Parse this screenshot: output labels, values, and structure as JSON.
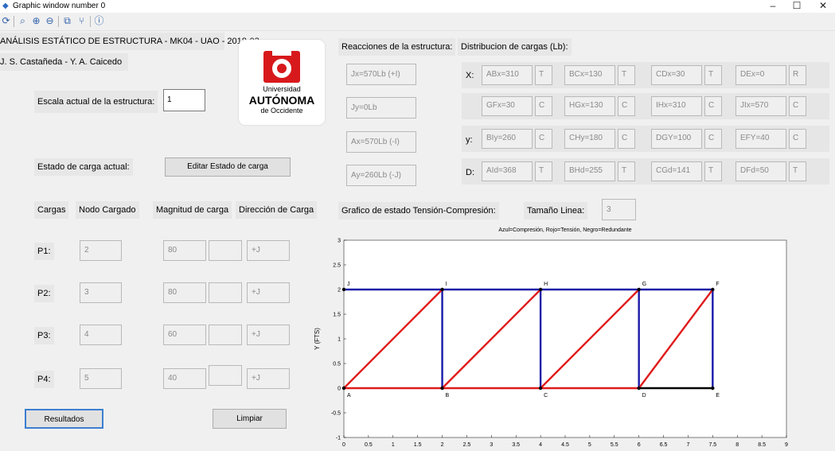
{
  "window": {
    "title": "Graphic window number 0",
    "controls": [
      "–",
      "☐",
      "✕"
    ]
  },
  "toolbar": {
    "icons": [
      "rotate-icon",
      "zoom-icon",
      "zoom-in-icon",
      "zoom-out-icon",
      "datatip-icon",
      "editor-icon",
      "help-icon"
    ]
  },
  "header": {
    "title": "ANÁLISIS ESTÁTICO DE ESTRUCTURA - MK04 - UAO - 2018-03",
    "authors": "J. S. Castañeda - Y. A. Caicedo",
    "logo": {
      "line1": "Universidad",
      "line2": "AUTÓNOMA",
      "line3": "de Occidente",
      "color": "#d7191c"
    }
  },
  "scale": {
    "label": "Escala actual de la estructura:",
    "value": "1"
  },
  "load_state": {
    "label": "Estado de carga actual:",
    "edit_button": "Editar Estado de carga"
  },
  "loads": {
    "headers": [
      "Cargas",
      "Nodo Cargado",
      "Magnitud de carga",
      "Dirección de Carga"
    ],
    "rows": [
      {
        "name": "P1:",
        "node": "2",
        "magnitude": "80",
        "extra": "",
        "direction": "+J"
      },
      {
        "name": "P2:",
        "node": "3",
        "magnitude": "80",
        "extra": "",
        "direction": "+J"
      },
      {
        "name": "P3:",
        "node": "4",
        "magnitude": "60",
        "extra": "",
        "direction": "+J"
      },
      {
        "name": "P4:",
        "node": "5",
        "magnitude": "40",
        "extra": "",
        "direction": "+J"
      }
    ]
  },
  "buttons": {
    "results": "Resultados",
    "clear": "Limpiar"
  },
  "reactions": {
    "label": "Reacciones de la estructura:",
    "values": [
      "Jx=570Lb (+I)",
      "Jy=0Lb",
      "Ax=570Lb (-I)",
      "Ay=260Lb (-J)"
    ]
  },
  "distribution": {
    "label": "Distribucion de cargas (Lb):",
    "rows": [
      {
        "axis": "X:",
        "items": [
          [
            "ABx=310",
            "T"
          ],
          [
            "BCx=130",
            "T"
          ],
          [
            "CDx=30",
            "T"
          ],
          [
            "DEx=0",
            "R"
          ]
        ]
      },
      {
        "axis": "",
        "items": [
          [
            "GFx=30",
            "C"
          ],
          [
            "HGx=130",
            "C"
          ],
          [
            "IHx=310",
            "C"
          ],
          [
            "JIx=570",
            "C"
          ]
        ]
      },
      {
        "axis": "y:",
        "items": [
          [
            "BIy=260",
            "C"
          ],
          [
            "CHy=180",
            "C"
          ],
          [
            "DGY=100",
            "C"
          ],
          [
            "EFY=40",
            "C"
          ]
        ]
      },
      {
        "axis": "D:",
        "items": [
          [
            "AId=368",
            "T"
          ],
          [
            "BHd=255",
            "T"
          ],
          [
            "CGd=141",
            "T"
          ],
          [
            "DFd=50",
            "T"
          ]
        ]
      }
    ]
  },
  "graph_controls": {
    "label": "Grafico de estado Tensión-Compresión:",
    "line_size_label": "Tamaño Linea:",
    "line_size": "3"
  },
  "chart_data": {
    "type": "line",
    "title": "Azul=Compresión, Rojo=Tensión, Negro=Redundante",
    "ylabel": "Y (FTS)",
    "xlabel": "",
    "xlim": [
      0,
      9
    ],
    "ylim": [
      -1,
      3
    ],
    "xticks": [
      "0",
      "0.5",
      "1",
      "1.5",
      "2",
      "2.5",
      "3",
      "3.5",
      "4",
      "4.5",
      "5",
      "5.5",
      "6",
      "6.5",
      "7",
      "7.5",
      "8",
      "8.5",
      "9"
    ],
    "xtick_values": [
      0,
      0.5,
      1,
      1.5,
      2,
      2.5,
      3,
      3.5,
      4,
      4.5,
      5,
      5.5,
      6,
      6.5,
      7,
      7.5,
      8,
      8.5,
      9
    ],
    "yticks": [
      "3",
      "2.5",
      "2",
      "1.5",
      "1",
      "0.5",
      "0",
      "-0.5",
      "-1"
    ],
    "ytick_values": [
      3,
      2.5,
      2,
      1.5,
      1,
      0.5,
      0,
      -0.5,
      -1
    ],
    "colors": {
      "compression": "#1a1aa8",
      "tension": "#e01b1b",
      "redundant": "#000000"
    },
    "nodes": [
      {
        "name": "A",
        "x": 0,
        "y": 0
      },
      {
        "name": "B",
        "x": 2,
        "y": 0
      },
      {
        "name": "C",
        "x": 4,
        "y": 0
      },
      {
        "name": "D",
        "x": 6,
        "y": 0
      },
      {
        "name": "E",
        "x": 7.5,
        "y": 0
      },
      {
        "name": "F",
        "x": 7.5,
        "y": 2
      },
      {
        "name": "G",
        "x": 6,
        "y": 2
      },
      {
        "name": "H",
        "x": 4,
        "y": 2
      },
      {
        "name": "I",
        "x": 2,
        "y": 2
      },
      {
        "name": "J",
        "x": 0,
        "y": 2
      }
    ],
    "members": [
      {
        "name": "AB",
        "from": "A",
        "to": "B",
        "state": "tension"
      },
      {
        "name": "BC",
        "from": "B",
        "to": "C",
        "state": "tension"
      },
      {
        "name": "CD",
        "from": "C",
        "to": "D",
        "state": "tension"
      },
      {
        "name": "DE",
        "from": "D",
        "to": "E",
        "state": "redundant"
      },
      {
        "name": "JI",
        "from": "J",
        "to": "I",
        "state": "compression"
      },
      {
        "name": "IH",
        "from": "I",
        "to": "H",
        "state": "compression"
      },
      {
        "name": "HG",
        "from": "H",
        "to": "G",
        "state": "compression"
      },
      {
        "name": "GF",
        "from": "G",
        "to": "F",
        "state": "compression"
      },
      {
        "name": "BI",
        "from": "B",
        "to": "I",
        "state": "compression"
      },
      {
        "name": "CH",
        "from": "C",
        "to": "H",
        "state": "compression"
      },
      {
        "name": "DG",
        "from": "D",
        "to": "G",
        "state": "compression"
      },
      {
        "name": "EF",
        "from": "E",
        "to": "F",
        "state": "compression"
      },
      {
        "name": "AI",
        "from": "A",
        "to": "I",
        "state": "tension"
      },
      {
        "name": "BH",
        "from": "B",
        "to": "H",
        "state": "tension"
      },
      {
        "name": "CG",
        "from": "C",
        "to": "G",
        "state": "tension"
      },
      {
        "name": "DF",
        "from": "D",
        "to": "F",
        "state": "tension"
      }
    ]
  }
}
